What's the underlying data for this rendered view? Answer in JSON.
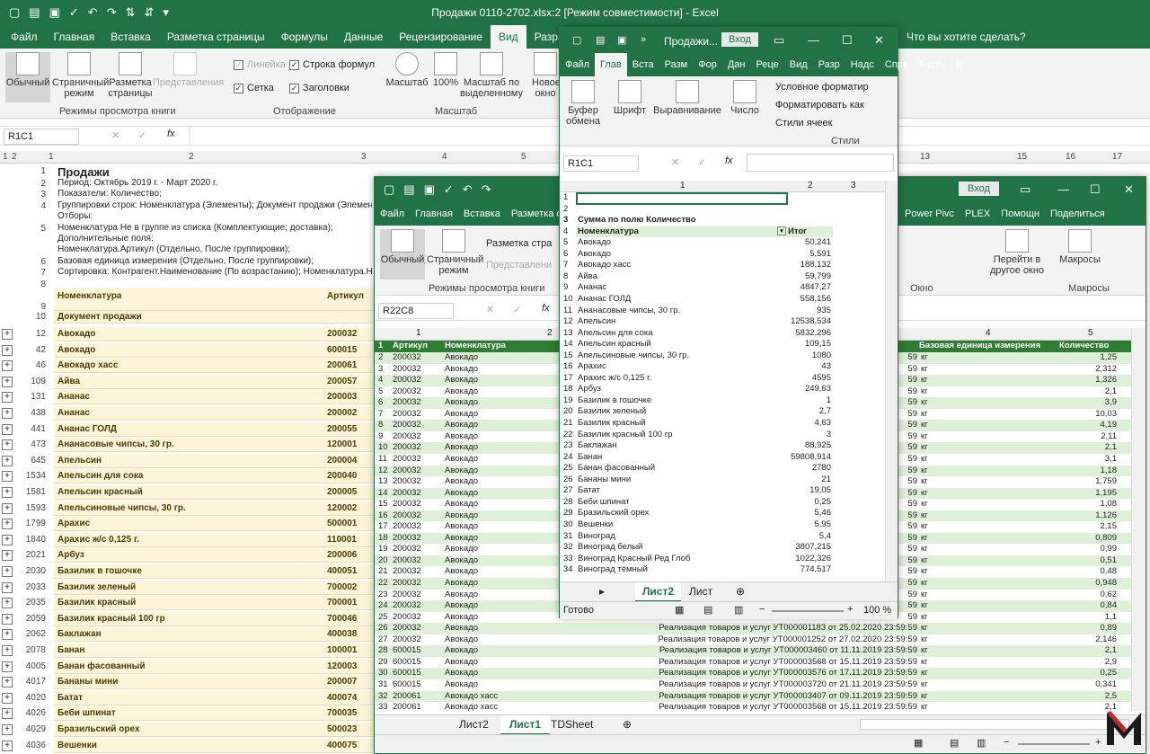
{
  "main": {
    "title": "Продажи 0110-2702.xlsx:2  [Режим совместимости]  -  Excel",
    "tabs": [
      "Файл",
      "Главная",
      "Вставка",
      "Разметка страницы",
      "Формулы",
      "Данные",
      "Рецензирование",
      "Вид",
      "Разработчик"
    ],
    "active_tab": "Вид",
    "help": "Что вы хотите сделать?",
    "ribbon": {
      "normal": "Обычный",
      "page_mode": "Страничный режим",
      "page_layout": "Разметка страницы",
      "views": "Представления",
      "group_views": "Режимы просмотра книги",
      "ruler": "Линейка",
      "formula_bar": "Строка формул",
      "grid": "Сетка",
      "headers": "Заголовки",
      "group_show": "Отображение",
      "zoom": "Масштаб",
      "zoom100": "100%",
      "zoom_sel": "Масштаб по выделенному",
      "group_zoom": "Масштаб",
      "new": "Новое окно"
    },
    "namebox": "R1C1",
    "col_headers": [
      "1",
      "2",
      "3",
      "4",
      "5",
      "13",
      "15",
      "16",
      "17"
    ],
    "outline_levels": [
      "1",
      "2"
    ],
    "header_rows": [
      {
        "r": "1",
        "a": "Продажи",
        "big": true
      },
      {
        "r": "2",
        "a": "Период: Октябрь 2019 г. - Март 2020 г."
      },
      {
        "r": "3",
        "a": "Показатели: Количество;"
      },
      {
        "r": "4",
        "a": "Группировки строк: Номенклатура (Элементы); Документ продажи (Элементы);"
      },
      {
        "r": "",
        "a": "Отборы:"
      },
      {
        "r": "5",
        "a": "Номенклатура Не в группе из списка (Комплектующие; доставка);"
      },
      {
        "r": "",
        "a": "Дополнительные поля:"
      },
      {
        "r": "",
        "a": "Номенклатура.Артикул  (Отдельно, После группировки);"
      },
      {
        "r": "6",
        "a": "Базовая единица измерения (Отдельно, После группировки);"
      },
      {
        "r": "7",
        "a": "Сортировка: Контрагент.Наименование (По возрастанию); Номенклатура.Наименование"
      },
      {
        "r": "8",
        "a": ""
      }
    ],
    "table_header": {
      "r9": "9",
      "nom": "Номенклатура",
      "art": "Артикул",
      "r10": "10",
      "doc": "Документ продажи"
    },
    "rows": [
      {
        "r": "12",
        "n": "Авокадо",
        "a": "200032"
      },
      {
        "r": "42",
        "n": "Авокадо",
        "a": "600015"
      },
      {
        "r": "46",
        "n": "Авокадо хасс",
        "a": "200061"
      },
      {
        "r": "109",
        "n": "Айва",
        "a": "200057"
      },
      {
        "r": "131",
        "n": "Ананас",
        "a": "200003"
      },
      {
        "r": "438",
        "n": "Ананас",
        "a": "200002"
      },
      {
        "r": "441",
        "n": "Ананас ГОЛД",
        "a": "200055"
      },
      {
        "r": "473",
        "n": "Ананасовые  чипсы, 30 гр.",
        "a": "120001"
      },
      {
        "r": "645",
        "n": "Апельсин",
        "a": "200004"
      },
      {
        "r": "1534",
        "n": "Апельсин для сока",
        "a": "200040"
      },
      {
        "r": "1581",
        "n": "Апельсин красный",
        "a": "200005"
      },
      {
        "r": "1593",
        "n": "Апельсиновые чипсы, 30 гр.",
        "a": "120002"
      },
      {
        "r": "1799",
        "n": "Арахис",
        "a": "500001"
      },
      {
        "r": "1840",
        "n": "Арахис ж/с 0,125 г.",
        "a": "110001"
      },
      {
        "r": "2021",
        "n": "Арбуз",
        "a": "200006"
      },
      {
        "r": "2030",
        "n": "Базилик в гошочке",
        "a": "400051"
      },
      {
        "r": "2033",
        "n": "Базилик зеленый",
        "a": "700002"
      },
      {
        "r": "2035",
        "n": "Базилик красный",
        "a": "700001"
      },
      {
        "r": "2059",
        "n": "Базилик красный 100 гр",
        "a": "700046"
      },
      {
        "r": "2062",
        "n": "Баклажан",
        "a": "400038"
      },
      {
        "r": "2078",
        "n": "Банан",
        "a": "100001"
      },
      {
        "r": "4005",
        "n": "Банан фасованный",
        "a": "120003"
      },
      {
        "r": "4017",
        "n": "Бананы мини",
        "a": "200007"
      },
      {
        "r": "4020",
        "n": "Батат",
        "a": "400074"
      },
      {
        "r": "4026",
        "n": "Беби шпинат",
        "a": "700035"
      },
      {
        "r": "4029",
        "n": "Бразильский орех",
        "a": "500023"
      },
      {
        "r": "4036",
        "n": "Вешенки",
        "a": "400075"
      }
    ]
  },
  "win2": {
    "tabs": [
      "Файл",
      "Главная",
      "Вставка",
      "Разметка с"
    ],
    "right_tabs": [
      "Power Pivc",
      "PLEX",
      "Помощн",
      "Поделиться"
    ],
    "login": "Вход",
    "ribbon": {
      "normal": "Обычный",
      "page_mode": "Страничный режим",
      "page_layout": "Разметка стра",
      "views": "Представлени",
      "group": "Режимы просмотра книги",
      "goto": "Перейти в другое окно",
      "macros": "Макросы",
      "window": "Окно",
      "macros_g": "Макросы"
    },
    "namebox": "R22C8",
    "col_headers": [
      "1",
      "2",
      "4",
      "5"
    ],
    "hdr": {
      "art": "Артикул",
      "nom": "Номенклатура",
      "unit": "Базовая единица измерения",
      "qty": "Количество"
    },
    "rows": [
      {
        "r": "2",
        "a": "200032",
        "n": "Авокадо",
        "d": "59",
        "u": "кг",
        "q": "1,25"
      },
      {
        "r": "3",
        "a": "200032",
        "n": "Авокадо",
        "d": "59",
        "u": "кг",
        "q": "2,312"
      },
      {
        "r": "4",
        "a": "200032",
        "n": "Авокадо",
        "d": "59",
        "u": "кг",
        "q": "1,326"
      },
      {
        "r": "5",
        "a": "200032",
        "n": "Авокадо",
        "d": "59",
        "u": "кг",
        "q": "2,1"
      },
      {
        "r": "6",
        "a": "200032",
        "n": "Авокадо",
        "d": "59",
        "u": "кг",
        "q": "3,9"
      },
      {
        "r": "7",
        "a": "200032",
        "n": "Авокадо",
        "d": "59",
        "u": "кг",
        "q": "10,03"
      },
      {
        "r": "8",
        "a": "200032",
        "n": "Авокадо",
        "d": "59",
        "u": "кг",
        "q": "4,19"
      },
      {
        "r": "9",
        "a": "200032",
        "n": "Авокадо",
        "d": "59",
        "u": "кг",
        "q": "2,11"
      },
      {
        "r": "10",
        "a": "200032",
        "n": "Авокадо",
        "d": "59",
        "u": "кг",
        "q": "2,1"
      },
      {
        "r": "11",
        "a": "200032",
        "n": "Авокадо",
        "d": "59",
        "u": "кг",
        "q": "3,1"
      },
      {
        "r": "12",
        "a": "200032",
        "n": "Авокадо",
        "d": "59",
        "u": "кг",
        "q": "1,18"
      },
      {
        "r": "13",
        "a": "200032",
        "n": "Авокадо",
        "d": "59",
        "u": "кг",
        "q": "1,759"
      },
      {
        "r": "14",
        "a": "200032",
        "n": "Авокадо",
        "d": "59",
        "u": "кг",
        "q": "1,195"
      },
      {
        "r": "15",
        "a": "200032",
        "n": "Авокадо",
        "d": "59",
        "u": "кг",
        "q": "1,08"
      },
      {
        "r": "16",
        "a": "200032",
        "n": "Авокадо",
        "d": "59",
        "u": "кг",
        "q": "1,126"
      },
      {
        "r": "17",
        "a": "200032",
        "n": "Авокадо",
        "d": "59",
        "u": "кг",
        "q": "2,15"
      },
      {
        "r": "18",
        "a": "200032",
        "n": "Авокадо",
        "d": "59",
        "u": "кг",
        "q": "0,809"
      },
      {
        "r": "19",
        "a": "200032",
        "n": "Авокадо",
        "d": "59",
        "u": "кг",
        "q": "0,99"
      },
      {
        "r": "20",
        "a": "200032",
        "n": "Авокадо",
        "d": "59",
        "u": "кг",
        "q": "0,51"
      },
      {
        "r": "21",
        "a": "200032",
        "n": "Авокадо",
        "d": "59",
        "u": "кг",
        "q": "0,48"
      },
      {
        "r": "22",
        "a": "200032",
        "n": "Авокадо",
        "d": "59",
        "u": "кг",
        "q": "0,948"
      },
      {
        "r": "23",
        "a": "200032",
        "n": "Авокадо",
        "d": "59",
        "u": "кг",
        "q": "0,62"
      },
      {
        "r": "24",
        "a": "200032",
        "n": "Авокадо",
        "d": "59",
        "u": "кг",
        "q": "0,84"
      },
      {
        "r": "25",
        "a": "200032",
        "n": "Авокадо",
        "d": "59",
        "u": "кг",
        "q": "1,1"
      },
      {
        "r": "26",
        "a": "200032",
        "n": "Авокадо",
        "d": "Реализация товаров и услуг УТ000001183 от 25.02.2020 23:59:59",
        "u": "кг",
        "q": "0,89"
      },
      {
        "r": "27",
        "a": "200032",
        "n": "Авокадо",
        "d": "Реализация товаров и услуг УТ000001252 от 27.02.2020 23:59:59",
        "u": "кг",
        "q": "2,146"
      },
      {
        "r": "28",
        "a": "600015",
        "n": "Авокадо",
        "d": "Реализация товаров и услуг УТ000003460 от 11.11.2019 23:59:59",
        "u": "кг",
        "q": "2,1"
      },
      {
        "r": "29",
        "a": "600015",
        "n": "Авокадо",
        "d": "Реализация товаров и услуг УТ000003568 от 15.11.2019 23:59:59",
        "u": "кг",
        "q": "2,9"
      },
      {
        "r": "30",
        "a": "600015",
        "n": "Авокадо",
        "d": "Реализация товаров и услуг УТ000003576 от 17.11.2019 23:59:59",
        "u": "кг",
        "q": "0,25"
      },
      {
        "r": "31",
        "a": "600015",
        "n": "Авокадо",
        "d": "Реализация товаров и услуг УТ000003720 от 21.11.2019 23:59:59",
        "u": "кг",
        "q": "0,341"
      },
      {
        "r": "32",
        "a": "200061",
        "n": "Авокадо хасс",
        "d": "Реализация товаров и услуг УТ000003407 от 09.11.2019 23:59:59",
        "u": "кг",
        "q": "2,5"
      },
      {
        "r": "33",
        "a": "200061",
        "n": "Авокадо хасс",
        "d": "Реализация товаров и услуг УТ000003568 от 15.11.2019 23:59:59",
        "u": "кг",
        "q": "2,1"
      }
    ],
    "sheets": [
      "Лист2",
      "Лист1",
      "TDSheet"
    ],
    "active_sheet": "Лист1"
  },
  "win3": {
    "title": "Продажи...",
    "login": "Вход",
    "tabs": [
      "Файл",
      "Глав",
      "Вста",
      "Разм",
      "Фор",
      "Дан",
      "Реце",
      "Вид",
      "Разр",
      "Надс",
      "Спра",
      "Fuzzy",
      "Р"
    ],
    "ribbon": {
      "clip": "Буфер обмена",
      "font": "Шрифт",
      "align": "Выравнивание",
      "num": "Число",
      "cond": "Условное форматир",
      "fmt_table": "Форматировать как",
      "cell_styles": "Стили ячеек",
      "styles": "Стили"
    },
    "namebox": "R1C1",
    "cols": [
      "1",
      "2",
      "3"
    ],
    "pivot_title": "Сумма по полю Количество",
    "pivot_hdr": {
      "nom": "Номенклатура",
      "total": "Итог"
    },
    "rows": [
      {
        "r": "5",
        "n": "Авокадо",
        "v": "50,241"
      },
      {
        "r": "6",
        "n": "Авокадо",
        "v": "5,591"
      },
      {
        "r": "7",
        "n": "Авокадо хасс",
        "v": "188,132"
      },
      {
        "r": "8",
        "n": "Айва",
        "v": "59,799"
      },
      {
        "r": "9",
        "n": "Ананас",
        "v": "4847,27"
      },
      {
        "r": "10",
        "n": "Ананас ГОЛД",
        "v": "558,156"
      },
      {
        "r": "11",
        "n": "Ананасовые  чипсы, 30 гр.",
        "v": "935"
      },
      {
        "r": "12",
        "n": "Апельсин",
        "v": "12538,534"
      },
      {
        "r": "13",
        "n": "Апельсин для сока",
        "v": "5832,296"
      },
      {
        "r": "14",
        "n": "Апельсин красный",
        "v": "109,15"
      },
      {
        "r": "15",
        "n": "Апельсиновые чипсы, 30 гр.",
        "v": "1080"
      },
      {
        "r": "16",
        "n": "Арахис",
        "v": "43"
      },
      {
        "r": "17",
        "n": "Арахис ж/с 0,125 г.",
        "v": "4595"
      },
      {
        "r": "18",
        "n": "Арбуз",
        "v": "249,63"
      },
      {
        "r": "19",
        "n": "Базилик в гошочке",
        "v": "1"
      },
      {
        "r": "20",
        "n": "Базилик зеленый",
        "v": "2,7"
      },
      {
        "r": "21",
        "n": "Базилик красный",
        "v": "4,63"
      },
      {
        "r": "22",
        "n": "Базилик красный 100 гр",
        "v": "3"
      },
      {
        "r": "23",
        "n": "Баклажан",
        "v": "88,925"
      },
      {
        "r": "24",
        "n": "Банан",
        "v": "59808,914"
      },
      {
        "r": "25",
        "n": "Банан фасованный",
        "v": "2780"
      },
      {
        "r": "26",
        "n": "Бананы мини",
        "v": "21"
      },
      {
        "r": "27",
        "n": "Батат",
        "v": "19,05"
      },
      {
        "r": "28",
        "n": "Беби шпинат",
        "v": "0,25"
      },
      {
        "r": "29",
        "n": "Бразильский орех",
        "v": "5,46"
      },
      {
        "r": "30",
        "n": "Вешенки",
        "v": "5,95"
      },
      {
        "r": "31",
        "n": "Виноград",
        "v": "5,4"
      },
      {
        "r": "32",
        "n": "Виноград белый",
        "v": "3807,215"
      },
      {
        "r": "33",
        "n": "Виноград Красный Ред Глоб",
        "v": "1022,326"
      },
      {
        "r": "34",
        "n": "Виноград тёмный",
        "v": "774,517"
      }
    ],
    "sheets": [
      "Лист2",
      "Лист"
    ],
    "status": "Готово",
    "zoom": "100 %"
  },
  "colors": {
    "green": "#217346",
    "band": "#fdf5d9",
    "pivot": "#dff0d8"
  }
}
